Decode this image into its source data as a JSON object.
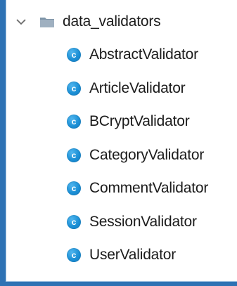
{
  "tree": {
    "folder": {
      "label": "data_validators",
      "icon": "folder-icon",
      "expanded": true
    },
    "classes": [
      {
        "label": "AbstractValidator",
        "icon_glyph": "c"
      },
      {
        "label": "ArticleValidator",
        "icon_glyph": "c"
      },
      {
        "label": "BCryptValidator",
        "icon_glyph": "c"
      },
      {
        "label": "CategoryValidator",
        "icon_glyph": "c"
      },
      {
        "label": "CommentValidator",
        "icon_glyph": "c"
      },
      {
        "label": "SessionValidator",
        "icon_glyph": "c"
      },
      {
        "label": "UserValidator",
        "icon_glyph": "c"
      }
    ]
  },
  "colors": {
    "background": "#2e72b4",
    "panel": "#ffffff",
    "class_icon": "#1b8fd5",
    "text": "#1b1b1b"
  }
}
